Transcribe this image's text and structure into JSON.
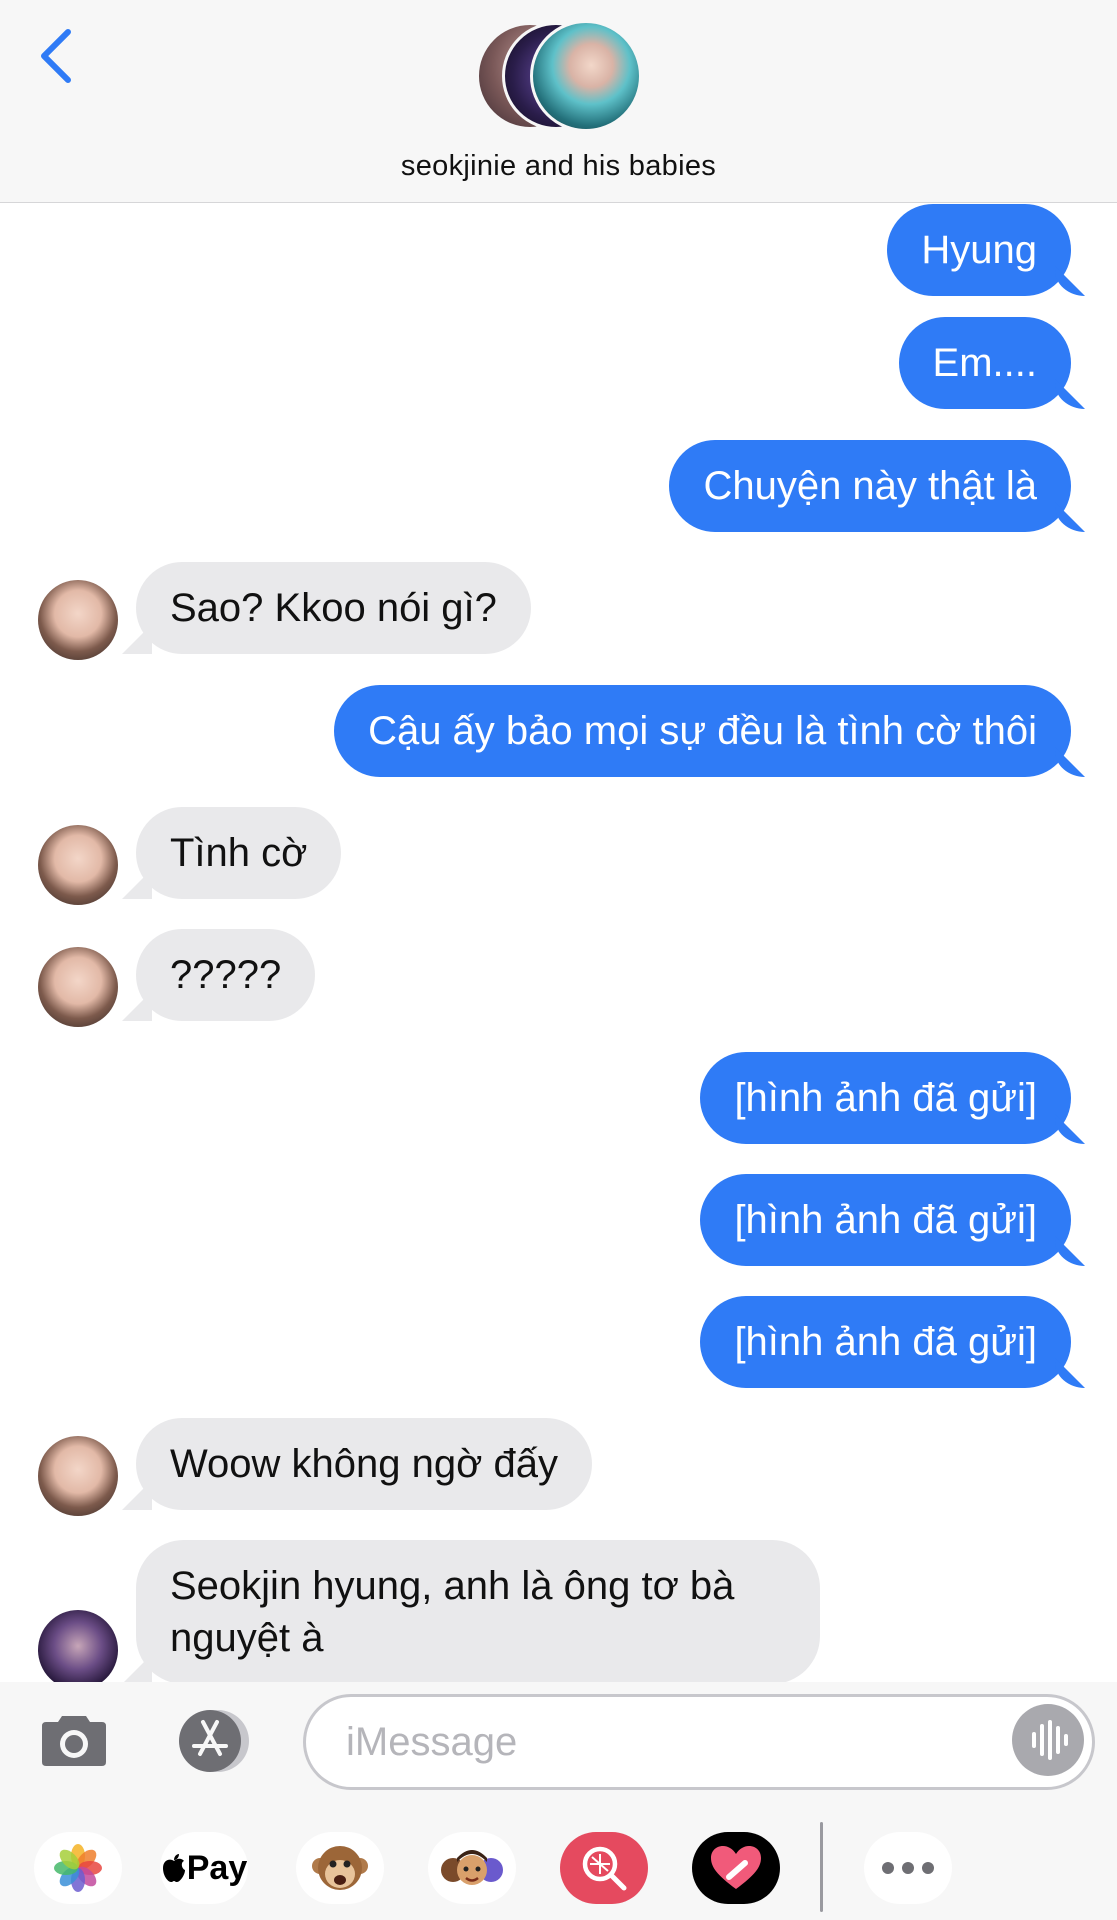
{
  "header": {
    "back_icon": "chevron-left-icon",
    "group_name": "seokjinie and his babies",
    "accent_color": "#2f7bf6"
  },
  "messages": [
    {
      "side": "out",
      "text": "Hyung"
    },
    {
      "side": "out",
      "text": "Em...."
    },
    {
      "side": "out",
      "text": "Chuyện này thật là"
    },
    {
      "side": "in",
      "text": "Sao? Kkoo nói gì?"
    },
    {
      "side": "out",
      "text": "Cậu ấy bảo mọi sự đều là tình cờ thôi"
    },
    {
      "side": "in",
      "text": "Tình cờ"
    },
    {
      "side": "in",
      "text": "?????"
    },
    {
      "side": "out",
      "text": "[hình ảnh đã gửi]"
    },
    {
      "side": "out",
      "text": "[hình ảnh đã gửi]"
    },
    {
      "side": "out",
      "text": "[hình ảnh đã gửi]"
    },
    {
      "side": "in",
      "text": "Woow không ngờ đấy"
    },
    {
      "side": "in",
      "text": "Seokjin hyung, anh là ông tơ bà nguyệt à"
    }
  ],
  "compose": {
    "placeholder": "iMessage",
    "camera_icon": "camera-icon",
    "appstore_icon": "app-store-icon",
    "mic_icon": "audio-waveform-icon"
  },
  "app_tray": {
    "items": [
      {
        "icon": "photos-icon"
      },
      {
        "icon": "apple-pay-icon",
        "label": "Pay"
      },
      {
        "icon": "animoji-monkey-icon"
      },
      {
        "icon": "memoji-icon"
      },
      {
        "icon": "search-images-icon"
      },
      {
        "icon": "digital-touch-heart-icon"
      },
      {
        "icon": "more-icon"
      }
    ]
  },
  "colors": {
    "outgoing_bubble": "#2f7bf6",
    "incoming_bubble": "#e9e9eb",
    "header_bg": "#f7f7f7"
  }
}
